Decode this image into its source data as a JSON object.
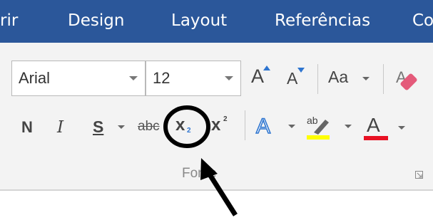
{
  "tabs": [
    {
      "label": "rir"
    },
    {
      "label": "Design"
    },
    {
      "label": "Layout"
    },
    {
      "label": "Referências"
    },
    {
      "label": "Co"
    }
  ],
  "font": {
    "name": "Arial",
    "size": "12",
    "grow_label": "A",
    "shrink_label": "A",
    "case_label": "Aa",
    "bold_label": "N",
    "italic_label": "I",
    "underline_label": "S",
    "strike_label": "abc",
    "subscript_label": "x",
    "subscript_small": "2",
    "superscript_label": "x",
    "superscript_small": "2",
    "highlight_label": "ab",
    "fontcolor_label": "A",
    "group_label": "Fonte"
  },
  "colors": {
    "tabbar": "#2b579a",
    "highlight": "#ffff00",
    "font_color": "#e81123",
    "text_effects": "#2e75d0",
    "annotation": "#000000"
  },
  "icons": [
    "grow-font-icon",
    "shrink-font-icon",
    "clear-formatting-icon",
    "text-effects-icon",
    "highlight-icon",
    "font-color-icon",
    "dialog-launcher-icon"
  ]
}
